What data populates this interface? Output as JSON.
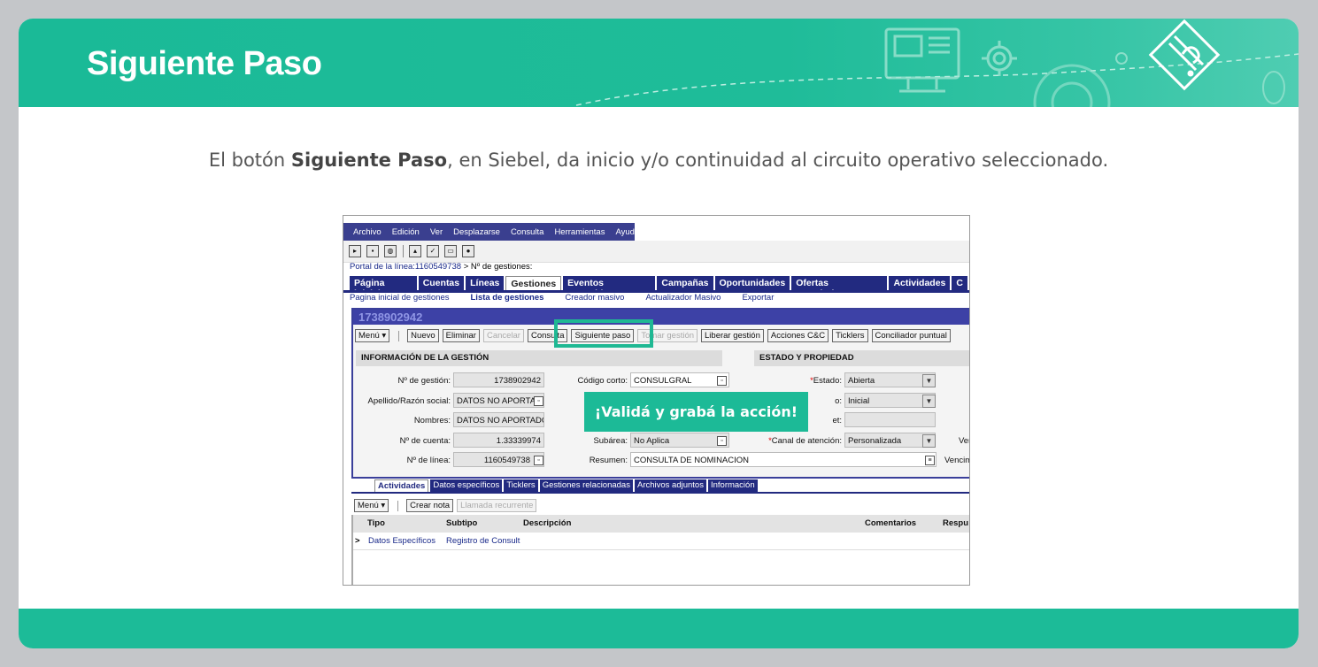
{
  "slide": {
    "title": "Siguiente Paso",
    "intro_before": "El botón ",
    "intro_bold": "Siguiente Paso",
    "intro_after": ", en Siebel, da inicio y/o continuidad al circuito operativo seleccionado.",
    "callout": "¡Validá y grabá la acción!"
  },
  "app": {
    "menu": [
      "Archivo",
      "Edición",
      "Ver",
      "Desplazarse",
      "Consulta",
      "Herramientas",
      "Ayuda"
    ],
    "breadcrumb_link": "Portal de la línea:1160549738",
    "breadcrumb_current": " > Nº de gestiones:",
    "tabs": [
      "Página inicial",
      "Cuentas",
      "Líneas",
      "Gestiones",
      "Eventos conocidos",
      "Campañas",
      "Oportunidades",
      "Ofertas económicas",
      "Actividades",
      "C"
    ],
    "subnav": [
      "Pagina inicial de gestiones",
      "Lista de gestiones",
      "Creador masivo",
      "Actualizador Masivo",
      "Exportar"
    ],
    "record_id": "1738902942",
    "buttons": {
      "menu": "Menú ▾",
      "nuevo": "Nuevo",
      "eliminar": "Eliminar",
      "cancelar": "Cancelar",
      "consulta": "Consulta",
      "siguiente": "Siguiente paso",
      "tomar": "Tomar gestión",
      "liberar": "Liberar gestión",
      "acciones": "Acciones C&C",
      "ticklers": "Ticklers",
      "conciliador": "Conciliador puntual"
    },
    "sections": {
      "info": "INFORMACIÓN DE LA GESTIÓN",
      "estado": "ESTADO Y PROPIEDAD"
    },
    "fields": {
      "nro_gestion_label": "Nº de gestión:",
      "nro_gestion": "1738902942",
      "apellido_label": "Apellido/Razón social:",
      "apellido": "DATOS NO APORTAD",
      "nombres_label": "Nombres:",
      "nombres": "DATOS NO APORTADOS",
      "cuenta_label": "Nº de cuenta:",
      "cuenta": "1.33339974",
      "linea_label": "Nº de línea:",
      "linea": "1160549738",
      "codigo_label": "Código corto:",
      "codigo": "CONSULGRAL",
      "subarea_label": "Subárea:",
      "subarea": "No Aplica",
      "resumen_label": "Resumen:",
      "resumen": "CONSULTA DE NOMINACION",
      "estado_label": "Estado:",
      "estado": "Abierta",
      "subestado_label": "o:",
      "subestado": "Inicial",
      "et_label": "et:",
      "canal_label": "Canal de atención:",
      "canal": "Personalizada",
      "ver_label": "Ver",
      "venc_label": "Vencim"
    },
    "lower_tabs": [
      "Actividades",
      "Datos específicos",
      "Ticklers",
      "Gestiones relacionadas",
      "Archivos adjuntos",
      "Información"
    ],
    "lower_buttons": {
      "menu": "Menú ▾",
      "crear_nota": "Crear nota",
      "llamada": "Llamada recurrente"
    },
    "grid_headers": [
      "Tipo",
      "Subtipo",
      "Descripción",
      "Comentarios",
      "Respu"
    ],
    "grid_rows": [
      {
        "tipo": "Datos Específicos",
        "subtipo": "Registro de Consult"
      }
    ]
  },
  "colors": {
    "brand_green": "#1cba97",
    "siebel_blue": "#222a80"
  }
}
